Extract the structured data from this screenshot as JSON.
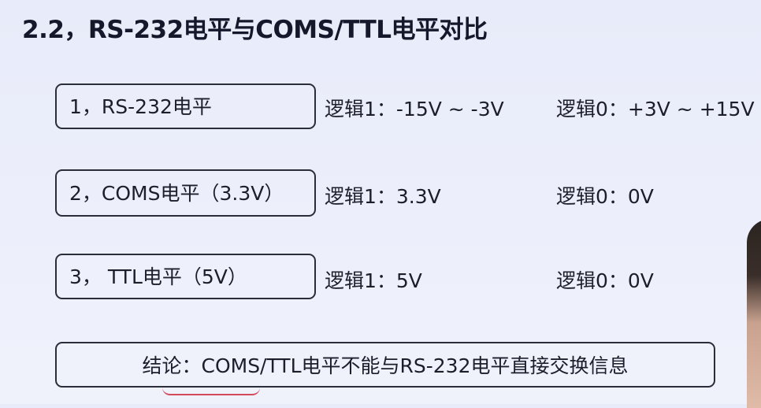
{
  "title": "2.2，RS-232电平与COMS/TTL电平对比",
  "items": [
    {
      "label": "1，RS-232电平",
      "logic1": "逻辑1：-15V ~ -3V",
      "logic0": "逻辑0：+3V ~ +15V"
    },
    {
      "label": "2，COMS电平（3.3V）",
      "logic1": "逻辑1：3.3V",
      "logic0": "逻辑0：0V"
    },
    {
      "label": "3， TTL电平（5V）",
      "logic1": "逻辑1：5V",
      "logic0": "逻辑0：0V"
    }
  ],
  "conclusion": "结论：COMS/TTL电平不能与RS-232电平直接交换信息",
  "colors": {
    "background": "#eceffb",
    "text": "#1c1f2b",
    "box_border": "#2a2d3a",
    "annotation_mark": "#d24a5a"
  }
}
